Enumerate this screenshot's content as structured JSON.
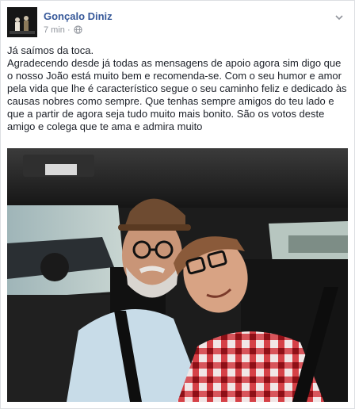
{
  "post": {
    "author": "Gonçalo Diniz",
    "time": "7 min",
    "separator": "·",
    "icons": {
      "audience": "globe-icon",
      "menu": "chevron-down-icon"
    },
    "text_lines": [
      "Já saímos da toca.",
      "Agradecendo desde já todas as mensagens de apoio agora sim digo que o nosso João está muito bem e recomenda-se. Com o seu humor e amor pela vida que lhe é característico segue o seu caminho feliz e dedicado às causas nobres como sempre. Que tenhas sempre amigos do teu lado e que a partir de agora seja tudo muito mais bonito. São os votos deste amigo e colega que te ama e admira muito"
    ]
  },
  "colors": {
    "author_link": "#365899",
    "meta_text": "#90949c",
    "body_text": "#1d2129",
    "border": "#dddfe2"
  }
}
